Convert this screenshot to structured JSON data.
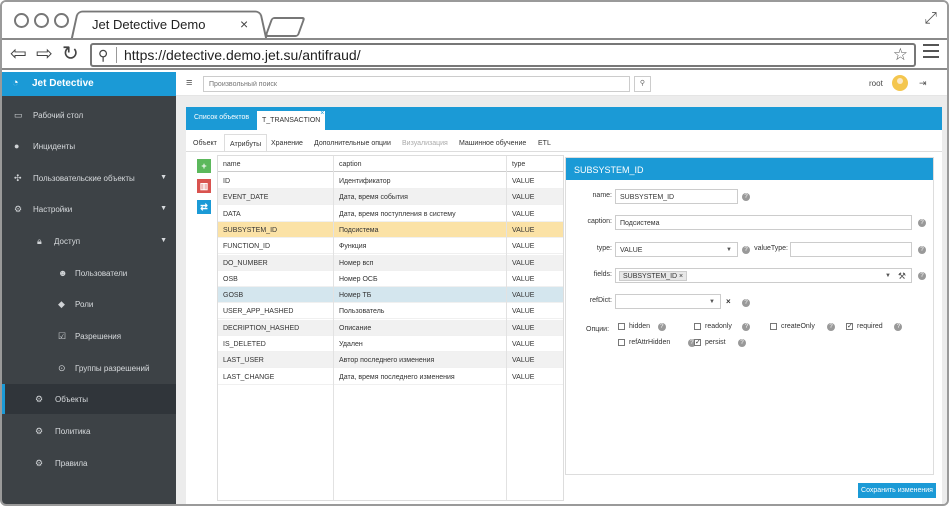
{
  "browser": {
    "tab_title": "Jet Detective Demo",
    "close_glyph": "×",
    "url": "https://detective.demo.jet.su/antifraud/"
  },
  "app": {
    "name": "Jet Detective",
    "accent_color": "#1b9ad6",
    "sidebar_color": "#3d4246"
  },
  "sidebar": {
    "items": [
      {
        "label": "Рабочий стол",
        "icon": "monitor-icon"
      },
      {
        "label": "Инциденты",
        "icon": "alert-icon"
      },
      {
        "label": "Пользовательские объекты",
        "icon": "network-icon"
      },
      {
        "label": "Настройки",
        "icon": "gears-icon"
      },
      {
        "label": "Доступ",
        "icon": "lock-icon"
      },
      {
        "label": "Пользователи",
        "icon": "users-icon"
      },
      {
        "label": "Роли",
        "icon": "tags-icon"
      },
      {
        "label": "Разрешения",
        "icon": "checkbox-icon"
      },
      {
        "label": "Группы разрешений",
        "icon": "target-icon"
      },
      {
        "label": "Объекты",
        "icon": "gears-icon"
      },
      {
        "label": "Политика",
        "icon": "gears-icon"
      },
      {
        "label": "Правила",
        "icon": "gears-icon"
      }
    ]
  },
  "topbar": {
    "search_placeholder": "Произвольный поиск",
    "user": "root"
  },
  "object_tabs": [
    "Список объектов",
    "T_TRANSACTION"
  ],
  "sub_tabs": [
    "Объект",
    "Атрибуты",
    "Хранение",
    "Дополнительные опции",
    "Визуализация",
    "Машинное обучение",
    "ETL"
  ],
  "table": {
    "headers": [
      "name",
      "caption",
      "type"
    ],
    "rows": [
      {
        "name": "ID",
        "caption": "Идентификатор",
        "type": "VALUE"
      },
      {
        "name": "EVENT_DATE",
        "caption": "Дата, время события",
        "type": "VALUE"
      },
      {
        "name": "DATA",
        "caption": "Дата, время поступления в систему",
        "type": "VALUE"
      },
      {
        "name": "SUBSYSTEM_ID",
        "caption": "Подсистема",
        "type": "VALUE"
      },
      {
        "name": "FUNCTION_ID",
        "caption": "Функция",
        "type": "VALUE"
      },
      {
        "name": "DO_NUMBER",
        "caption": "Номер всп",
        "type": "VALUE"
      },
      {
        "name": "OSB",
        "caption": "Номер ОСБ",
        "type": "VALUE"
      },
      {
        "name": "GOSB",
        "caption": "Номер ТБ",
        "type": "VALUE"
      },
      {
        "name": "USER_APP_HASHED",
        "caption": "Пользователь",
        "type": "VALUE"
      },
      {
        "name": "DECRIPTION_HASHED",
        "caption": "Описание",
        "type": "VALUE"
      },
      {
        "name": "IS_DELETED",
        "caption": "Удален",
        "type": "VALUE"
      },
      {
        "name": "LAST_USER",
        "caption": "Автор последнего изменения",
        "type": "VALUE"
      },
      {
        "name": "LAST_CHANGE",
        "caption": "Дата, время последнего изменения",
        "type": "VALUE"
      }
    ]
  },
  "editor": {
    "title": "SUBSYSTEM_ID",
    "name_label": "name:",
    "name_value": "SUBSYSTEM_ID",
    "caption_label": "caption:",
    "caption_value": "Подсистема",
    "type_label": "type:",
    "type_value": "VALUE",
    "valuetype_label": "valueType:",
    "fields_label": "fields:",
    "fields_chip": "SUBSYSTEM_ID",
    "refdict_label": "refDict:",
    "options_label": "Опции:",
    "options": [
      {
        "label": "hidden",
        "checked": false
      },
      {
        "label": "readonly",
        "checked": false
      },
      {
        "label": "createOnly",
        "checked": false
      },
      {
        "label": "required",
        "checked": true
      },
      {
        "label": "refAttrHidden",
        "checked": false
      },
      {
        "label": "persist",
        "checked": true
      }
    ]
  },
  "save_button": "Сохранить изменения"
}
